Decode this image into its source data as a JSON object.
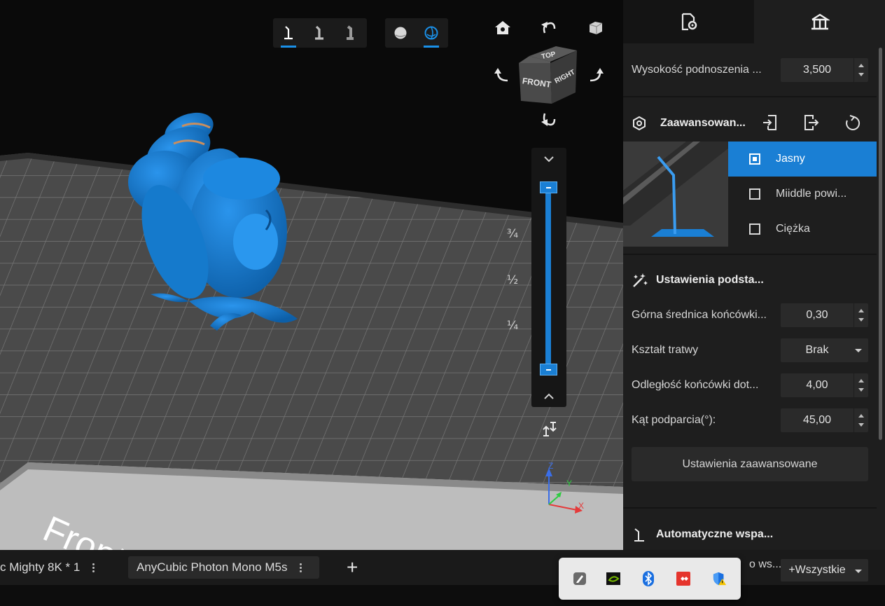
{
  "viewport": {
    "plate_label": "Front",
    "view_cube": {
      "top": "TOP",
      "front": "FRONT",
      "right": "RIGHT"
    },
    "layer_marks": [
      "¾",
      "½",
      "¼"
    ],
    "axes": {
      "x": "X",
      "y": "Y",
      "z": "Z"
    },
    "icons": {
      "toolbar_left": [
        "support-light-icon",
        "support-medium-icon",
        "support-heavy-icon"
      ],
      "toolbar_right": [
        "sphere-solid-icon",
        "sphere-wire-icon"
      ],
      "nav": [
        "home-icon",
        "undo-rotate-icon",
        "cube-icon",
        "rotate-left-icon",
        "rotate-right-icon",
        "rotate-down-icon"
      ]
    },
    "colors": {
      "model": "#1a7fd4",
      "accent": "#1a90e8"
    }
  },
  "panel": {
    "lift_height": {
      "label": "Wysokość podnoszenia ...",
      "value": "3,500"
    },
    "advanced": {
      "title": "Zaawansowan...",
      "options": [
        "Jasny",
        "Miiddle powi...",
        "Ciężka"
      ],
      "selected": "Jasny"
    },
    "basic": {
      "title": "Ustawienia podsta...",
      "top_diameter": {
        "label": "Górna średnica końcówki...",
        "value": "0,30"
      },
      "raft_shape": {
        "label": "Kształt tratwy",
        "value": "Brak"
      },
      "tip_distance": {
        "label": "Odległość końcówki dot...",
        "value": "4,00"
      },
      "support_angle": {
        "label": "Kąt podparcia(°):",
        "value": "45,00"
      },
      "advanced_button": "Ustawienia zaawansowane"
    },
    "auto": {
      "title": "Automatyczne wspa...",
      "partial_label": "o ws...",
      "select_value": "+Wszystkie"
    }
  },
  "bottom": {
    "tabs": [
      "c Mighty 8K * 1",
      "AnyCubic Photon Mono M5s"
    ],
    "add": "+"
  },
  "tray": [
    "pen-icon",
    "nvidia-icon",
    "bluetooth-icon",
    "anydesk-icon",
    "security-warning-icon"
  ]
}
